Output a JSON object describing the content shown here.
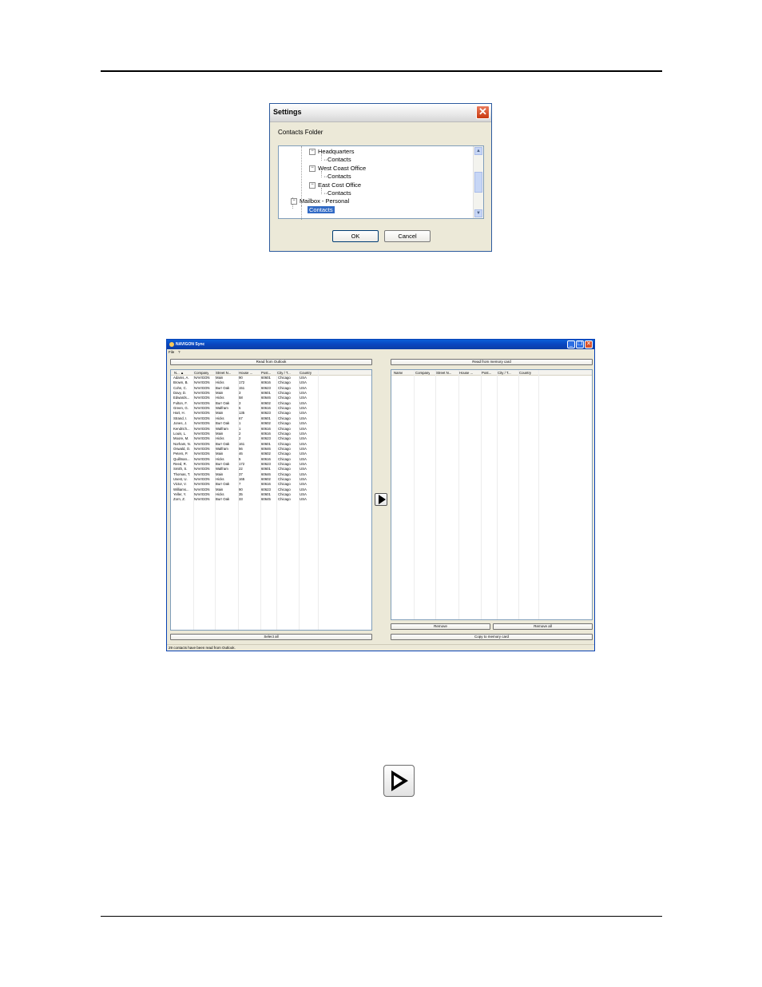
{
  "settings_dialog": {
    "title": "Settings",
    "close_glyph": "✕",
    "label": "Contacts Folder",
    "tree": [
      {
        "label": "Headquarters",
        "level": 2,
        "expander": "-"
      },
      {
        "label": "Contacts",
        "level": 3
      },
      {
        "label": "West Coast Office",
        "level": 2,
        "expander": "-"
      },
      {
        "label": "Contacts",
        "level": 3
      },
      {
        "label": "East Cost Office",
        "level": 2,
        "expander": "-"
      },
      {
        "label": "Contacts",
        "level": 3
      },
      {
        "label": "Mailbox - Personal",
        "level": 1,
        "expander": "-"
      },
      {
        "label": "Contacts",
        "level": 2,
        "selected": true
      }
    ],
    "ok_label": "OK",
    "cancel_label": "Cancel"
  },
  "sync_window": {
    "title": "NAVIGON Sync",
    "menu": [
      "File",
      "?"
    ],
    "read_outlook_label": "Read from Outlook",
    "read_card_label": "Read from memory card",
    "left_columns": [
      "N... ▲",
      "Company",
      "Street N...",
      "House ...",
      "Post...",
      "City / T...",
      "Country"
    ],
    "right_columns": [
      "Name",
      "Company",
      "Street N...",
      "House ...",
      "Post...",
      "City / T...",
      "Country"
    ],
    "contacts": [
      [
        "Adams, A.",
        "NAVIGON",
        "Main",
        "90",
        "60601",
        "Chicago",
        "USA"
      ],
      [
        "Brown, B.",
        "NAVIGON",
        "Hicks",
        "172",
        "60616",
        "Chicago",
        "USA"
      ],
      [
        "Cohn, C.",
        "NAVIGON",
        "Burr Oak",
        "151",
        "60623",
        "Chicago",
        "USA"
      ],
      [
        "Davy, D.",
        "NAVIGON",
        "Main",
        "3",
        "60601",
        "Chicago",
        "USA"
      ],
      [
        "Edwards...",
        "NAVIGON",
        "Hicks",
        "58",
        "60646",
        "Chicago",
        "USA"
      ],
      [
        "Fulton, F.",
        "NAVIGON",
        "Burr Oak",
        "3",
        "60602",
        "Chicago",
        "USA"
      ],
      [
        "Green, G.",
        "NAVIGON",
        "Walfram",
        "5",
        "60616",
        "Chicago",
        "USA"
      ],
      [
        "Hart, H.",
        "NAVIGON",
        "Main",
        "135",
        "60623",
        "Chicago",
        "USA"
      ],
      [
        "Strand, I.",
        "NAVIGON",
        "Hicks",
        "67",
        "60601",
        "Chicago",
        "USA"
      ],
      [
        "Jones, J.",
        "NAVIGON",
        "Burr Oak",
        "1",
        "60602",
        "Chicago",
        "USA"
      ],
      [
        "Kendrich...",
        "NAVIGON",
        "Walfram",
        "1",
        "60616",
        "Chicago",
        "USA"
      ],
      [
        "Louis, L.",
        "NAVIGON",
        "Main",
        "2",
        "60616",
        "Chicago",
        "USA"
      ],
      [
        "Moore, M.",
        "NAVIGON",
        "Hicks",
        "2",
        "60623",
        "Chicago",
        "USA"
      ],
      [
        "Norham, N.",
        "NAVIGON",
        "Burr Oak",
        "161",
        "60601",
        "Chicago",
        "USA"
      ],
      [
        "Oswald, O.",
        "NAVIGON",
        "Walfram",
        "56",
        "60646",
        "Chicago",
        "USA"
      ],
      [
        "Peters, P.",
        "NAVIGON",
        "Main",
        "46",
        "60602",
        "Chicago",
        "USA"
      ],
      [
        "Quillman...",
        "NAVIGON",
        "Hicks",
        "5",
        "60616",
        "Chicago",
        "USA"
      ],
      [
        "Reed, R.",
        "NAVIGON",
        "Burr Oak",
        "172",
        "60623",
        "Chicago",
        "USA"
      ],
      [
        "Smith, S.",
        "NAVIGON",
        "Walfram",
        "22",
        "60601",
        "Chicago",
        "USA"
      ],
      [
        "Thomas, T.",
        "NAVIGON",
        "Main",
        "37",
        "60646",
        "Chicago",
        "USA"
      ],
      [
        "Usest, U.",
        "NAVIGON",
        "Hicks",
        "165",
        "60602",
        "Chicago",
        "USA"
      ],
      [
        "Victor, V.",
        "NAVIGON",
        "Burr Oak",
        "7",
        "60616",
        "Chicago",
        "USA"
      ],
      [
        "Williams...",
        "NAVIGON",
        "Main",
        "90",
        "60623",
        "Chicago",
        "USA"
      ],
      [
        "Yeller, Y.",
        "NAVIGON",
        "Hicks",
        "35",
        "60601",
        "Chicago",
        "USA"
      ],
      [
        "Zorn, Z.",
        "NAVIGON",
        "Burr Oak",
        "33",
        "60645",
        "Chicago",
        "USA"
      ]
    ],
    "select_all_label": "Select all",
    "remove_label": "Remove",
    "remove_all_label": "Remove all",
    "copy_label": "Copy to memory card",
    "status_text": "29 contacts have been read from Outlook."
  }
}
